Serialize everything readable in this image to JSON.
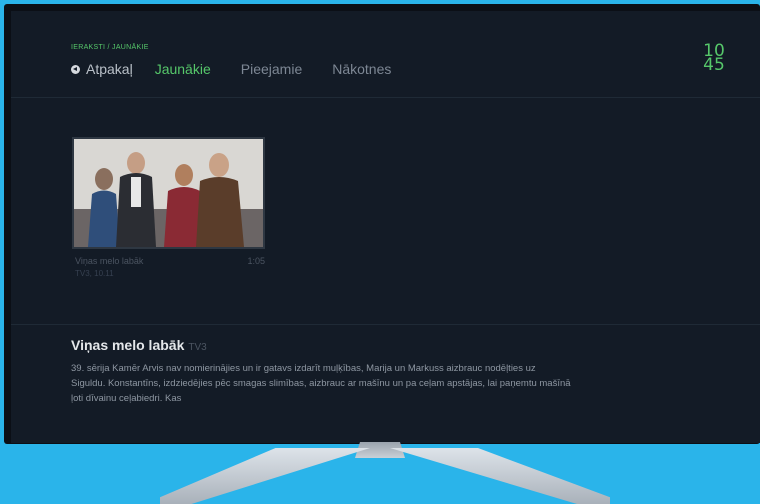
{
  "header": {
    "breadcrumb": "IERAKSTI / JAUNĀKIE",
    "back_label": "Atpakaļ",
    "tabs": [
      {
        "label": "Jaunākie",
        "active": true
      },
      {
        "label": "Pieejamie",
        "active": false
      },
      {
        "label": "Nākotnes",
        "active": false
      }
    ],
    "clock": {
      "hours": "10",
      "minutes": "45"
    }
  },
  "recordings": [
    {
      "title": "Viņas melo labāk",
      "duration": "1:05",
      "subtitle": "TV3, 10.11"
    }
  ],
  "detail": {
    "title": "Viņas melo labāk",
    "channel": "TV3",
    "description": "39. sērija Kamēr Arvis nav nomierinājies un ir gatavs izdarīt muļķības, Marija un Markuss aizbrauc nodēļties uz Siguldu. Konstantīns, izdziedējies pēc smagas slimības, aizbrauc ar mašīnu un pa ceļam apstājas, lai paņemtu mašīnā ļoti dīvainu ceļabiedri. Kas"
  },
  "colors": {
    "accent": "#56c76a",
    "background": "#131b26",
    "backdrop": "#2ab4ea"
  }
}
